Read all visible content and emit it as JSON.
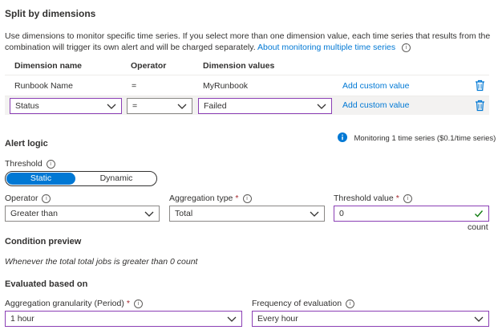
{
  "split": {
    "title": "Split by dimensions",
    "description_line1": "Use dimensions to monitor specific time series. If you select more than one dimension value, each time series that results from the",
    "description_line2": "combination will trigger its own alert and will be charged separately.",
    "link": "About monitoring multiple time series",
    "headers": {
      "name": "Dimension name",
      "operator": "Operator",
      "values": "Dimension values"
    },
    "rows": [
      {
        "name": "Runbook Name",
        "operator": "=",
        "value": "MyRunbook",
        "custom": "Add custom value"
      },
      {
        "name": "Status",
        "operator": "=",
        "value": "Failed",
        "custom": "Add custom value"
      }
    ],
    "monitoring_note": "Monitoring 1 time series ($0.1/time series)"
  },
  "alert_logic": {
    "title": "Alert logic",
    "threshold_label": "Threshold",
    "threshold_options": [
      "Static",
      "Dynamic"
    ],
    "threshold_selected": "Static",
    "operator_label": "Operator",
    "operator_value": "Greater than",
    "aggregation_label": "Aggregation type",
    "aggregation_value": "Total",
    "threshold_value_label": "Threshold value",
    "threshold_value": "0",
    "threshold_unit": "count"
  },
  "condition": {
    "title": "Condition preview",
    "text": "Whenever the total total jobs is greater than 0 count"
  },
  "evaluated": {
    "title": "Evaluated based on",
    "granularity_label": "Aggregation granularity (Period)",
    "granularity_value": "1 hour",
    "frequency_label": "Frequency of evaluation",
    "frequency_value": "Every hour"
  },
  "colors": {
    "accent": "#0078d4",
    "focus_border": "#8b3fb5",
    "required": "#a4262c",
    "success": "#107c10"
  }
}
